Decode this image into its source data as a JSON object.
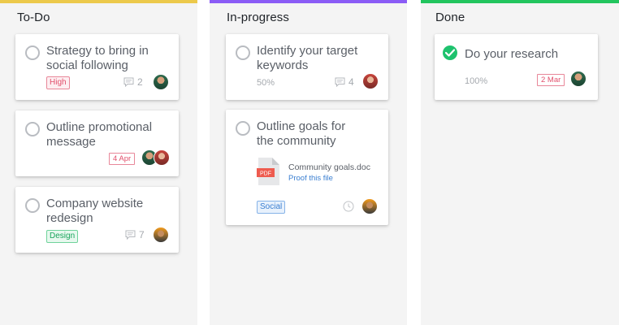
{
  "columns": [
    {
      "title": "To-Do",
      "color": "#ecc94b",
      "cards": [
        {
          "title": "Strategy to bring in social following",
          "tag": "High",
          "comments": "2"
        },
        {
          "title": "Outline promotional message",
          "date": "4 Apr"
        },
        {
          "title": "Company website redesign",
          "tag": "Design",
          "comments": "7"
        }
      ]
    },
    {
      "title": "In-progress",
      "color": "#8b5cf6",
      "cards": [
        {
          "title": "Identify your target keywords",
          "progress": "50%",
          "comments": "4"
        },
        {
          "title": "Outline goals for the community",
          "file_type": "PDF",
          "file_name": "Community goals.doc",
          "file_action": "Proof this file",
          "tag": "Social"
        }
      ]
    },
    {
      "title": "Done",
      "color": "#22c55e",
      "cards": [
        {
          "title": "Do your research",
          "progress": "100%",
          "date": "2 Mar",
          "completed": true
        }
      ]
    }
  ]
}
